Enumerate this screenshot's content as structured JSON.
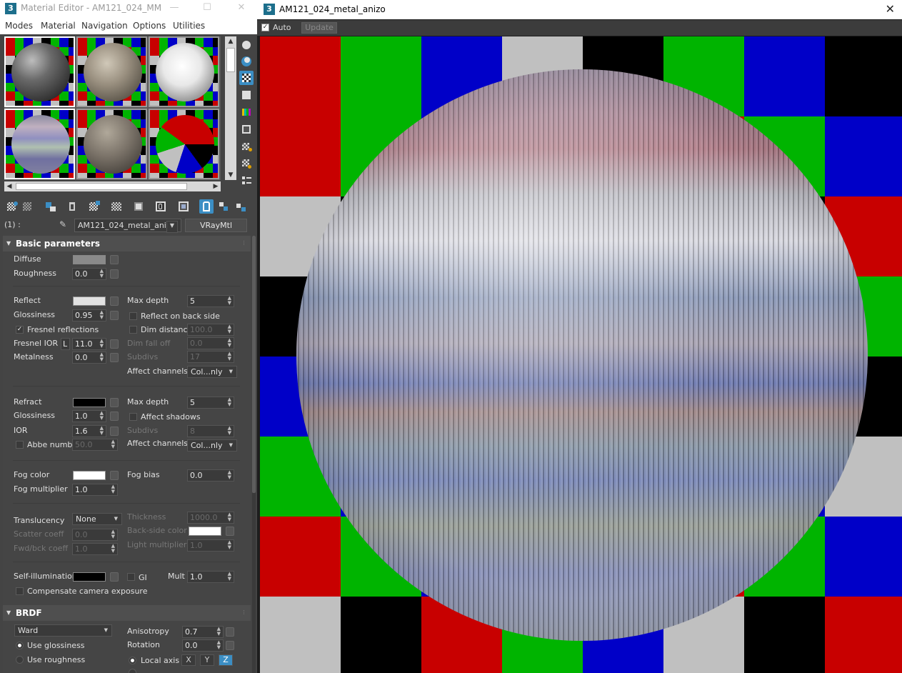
{
  "material_editor": {
    "title": "Material Editor - AM121_024_MM",
    "menu": [
      "Modes",
      "Material",
      "Navigation",
      "Options",
      "Utilities"
    ],
    "slot_label": "(1) :",
    "material_name": "AM121_024_metal_anizo",
    "material_type": "VRayMtl",
    "rollouts": {
      "basic": {
        "title": "Basic parameters",
        "diffuse": {
          "label": "Diffuse",
          "color": "#8a8a8a"
        },
        "roughness": {
          "label": "Roughness",
          "value": "0.0"
        },
        "reflect": {
          "label": "Reflect",
          "color": "#e2e2e2"
        },
        "reflect_max_depth": {
          "label": "Max depth",
          "value": "5"
        },
        "glossiness": {
          "label": "Glossiness",
          "value": "0.95"
        },
        "reflect_back": {
          "label": "Reflect on back side"
        },
        "fresnel": {
          "label": "Fresnel reflections"
        },
        "dim_distance": {
          "label": "Dim distance",
          "value": "100.0"
        },
        "fresnel_ior": {
          "label": "Fresnel IOR",
          "lock": "L",
          "value": "11.0"
        },
        "dim_falloff": {
          "label": "Dim fall off",
          "value": "0.0"
        },
        "metalness": {
          "label": "Metalness",
          "value": "0.0"
        },
        "reflect_subdivs": {
          "label": "Subdivs",
          "value": "17"
        },
        "reflect_affect": {
          "label": "Affect channels",
          "value": "Col...nly"
        },
        "refract": {
          "label": "Refract",
          "color": "#000000"
        },
        "refract_max_depth": {
          "label": "Max depth",
          "value": "5"
        },
        "refract_gloss": {
          "label": "Glossiness",
          "value": "1.0"
        },
        "affect_shadows": {
          "label": "Affect shadows"
        },
        "ior": {
          "label": "IOR",
          "value": "1.6"
        },
        "refract_subdivs": {
          "label": "Subdivs",
          "value": "8"
        },
        "abbe": {
          "label": "Abbe number",
          "value": "50.0"
        },
        "refract_affect": {
          "label": "Affect channels",
          "value": "Col...nly"
        },
        "fog_color": {
          "label": "Fog color",
          "color": "#ffffff"
        },
        "fog_bias": {
          "label": "Fog bias",
          "value": "0.0"
        },
        "fog_mult": {
          "label": "Fog multiplier",
          "value": "1.0"
        },
        "translucency": {
          "label": "Translucency",
          "value": "None"
        },
        "thickness": {
          "label": "Thickness",
          "value": "1000.0"
        },
        "scatter": {
          "label": "Scatter coeff",
          "value": "0.0"
        },
        "backside": {
          "label": "Back-side color",
          "color": "#ffffff"
        },
        "fwdbck": {
          "label": "Fwd/bck coeff",
          "value": "1.0"
        },
        "light_mult": {
          "label": "Light multiplier",
          "value": "1.0"
        },
        "selfillum": {
          "label": "Self-illumination",
          "color": "#000000"
        },
        "gi": {
          "label": "GI"
        },
        "mult": {
          "label": "Mult",
          "value": "1.0"
        },
        "comp_cam": {
          "label": "Compensate camera exposure"
        }
      },
      "brdf": {
        "title": "BRDF",
        "type": "Ward",
        "anisotropy": {
          "label": "Anisotropy",
          "value": "0.7"
        },
        "use_gloss": {
          "label": "Use glossiness"
        },
        "rotation": {
          "label": "Rotation",
          "value": "0.0"
        },
        "use_rough": {
          "label": "Use roughness"
        },
        "local_axis": {
          "label": "Local axis"
        },
        "axes": [
          "X",
          "Y",
          "Z"
        ]
      }
    }
  },
  "render_view": {
    "title": "AM121_024_metal_anizo",
    "auto_label": "Auto",
    "update_label": "Update"
  },
  "colors": {
    "checker_red": "#c80000",
    "checker_green": "#00b400",
    "checker_blue": "#0000c8",
    "checker_gray": "#c0c0c0",
    "checker_black": "#000000",
    "accent": "#3b8ec4"
  },
  "icons": [
    "sample-type-icon",
    "backlight-icon",
    "background-icon",
    "uv-tiling-icon",
    "video-check-icon",
    "make-preview-icon",
    "options-icon",
    "select-by-material-icon",
    "material-map-navigator-icon",
    "get-material-icon",
    "put-to-scene-icon",
    "assign-to-selection-icon",
    "reset-map-icon",
    "make-unique-icon",
    "put-to-library-icon",
    "material-id-icon",
    "show-shaded-icon",
    "show-end-result-icon",
    "go-to-parent-icon",
    "go-forward-icon",
    "pick-material-icon"
  ]
}
